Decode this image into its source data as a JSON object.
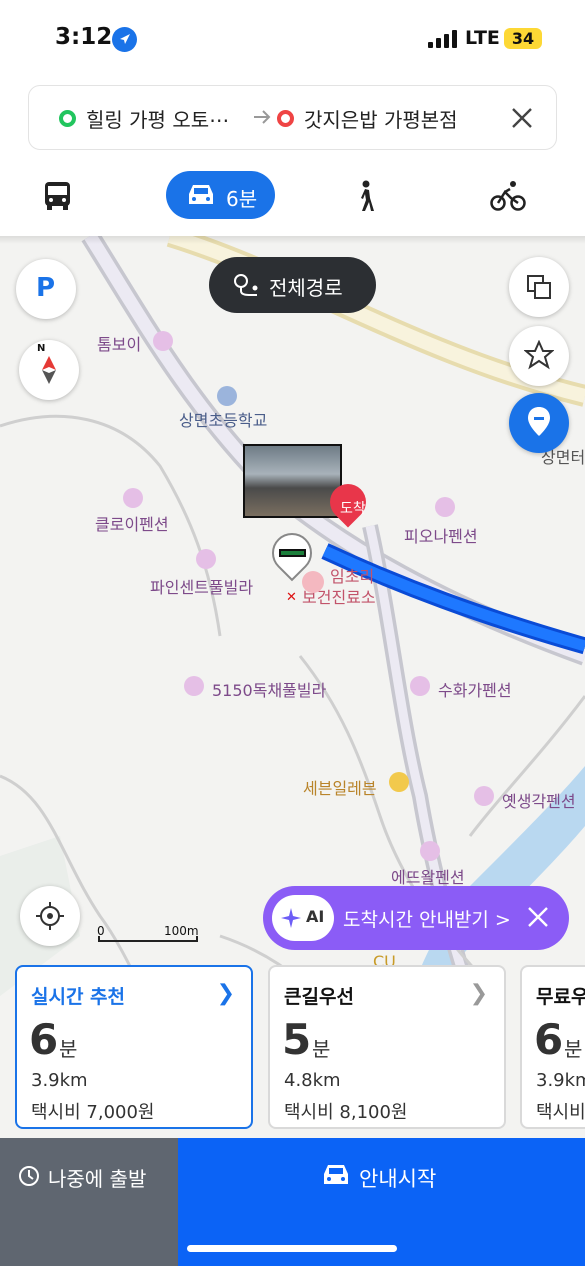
{
  "status_bar": {
    "time": "3:12",
    "network": "LTE",
    "battery": "34"
  },
  "route": {
    "origin": "힐링 가평 오토⋯",
    "destination": "갓지은밥 가평본점"
  },
  "modes": {
    "car_time": "6분"
  },
  "map": {
    "full_route_label": "전체경로",
    "parking_label": "P",
    "compass_label": "N",
    "scale_zero": "0",
    "scale_label": "100m",
    "pois": [
      "톰보이",
      "상면초등학교",
      "클로이펜션",
      "파인센트풀빌라",
      "임초리",
      "보건진료소",
      "피오나펜션",
      "5150독채풀빌라",
      "수화가펜션",
      "세븐일레븐",
      "옛생각펜션",
      "에뜨왈펜션",
      "상면터",
      "CU"
    ],
    "arrival_tag": "도착",
    "ai_badge": "AI",
    "ai_prompt": "도착시간 안내받기 >"
  },
  "route_cards": [
    {
      "title": "실시간 추천",
      "minutes": "6",
      "unit": "분",
      "distance": "3.9km",
      "fare": "택시비 7,000원"
    },
    {
      "title": "큰길우선",
      "minutes": "5",
      "unit": "분",
      "distance": "4.8km",
      "fare": "택시비 8,100원"
    },
    {
      "title": "무료우",
      "minutes": "6",
      "unit": "분",
      "distance": "3.9km",
      "fare": "택시비"
    }
  ],
  "bottom": {
    "later_label": "나중에 출발",
    "start_label": "안내시작"
  },
  "colors": {
    "accent": "#1a73e8",
    "start_bg": "#0b63f6",
    "later_bg": "#5f6670",
    "ai": "#8b5cf6"
  }
}
